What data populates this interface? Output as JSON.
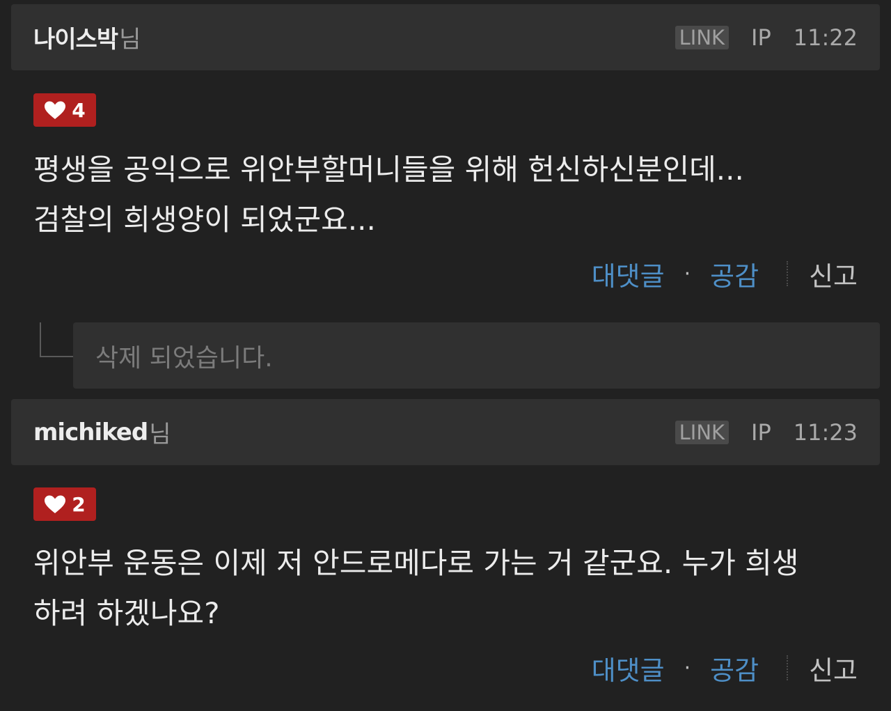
{
  "comments": [
    {
      "author": "나이스박",
      "suffix": "님",
      "link_label": "LINK",
      "ip_label": "IP",
      "time": "11:22",
      "likes": "4",
      "body_lines": [
        "평생을 공익으로 위안부할머니들을 위해 헌신하신분인데...",
        "검찰의 희생양이 되었군요..."
      ],
      "actions": {
        "reply": "대댓글",
        "dot": "·",
        "empathy": "공감",
        "report": "신고"
      }
    },
    {
      "author": "michiked",
      "suffix": "님",
      "link_label": "LINK",
      "ip_label": "IP",
      "time": "11:23",
      "likes": "2",
      "body_lines": [
        "위안부 운동은 이제 저 안드로메다로 가는 거 같군요. 누가 희생",
        "하려 하겠나요?"
      ],
      "actions": {
        "reply": "대댓글",
        "dot": "·",
        "empathy": "공감",
        "report": "신고"
      }
    }
  ],
  "deleted_reply": {
    "text": "삭제 되었습니다."
  },
  "icons": {
    "like": "heart-icon"
  },
  "colors": {
    "background": "#212121",
    "header_bg": "#303030",
    "like_badge": "#b0201f",
    "action_link": "#4e8fc7"
  }
}
